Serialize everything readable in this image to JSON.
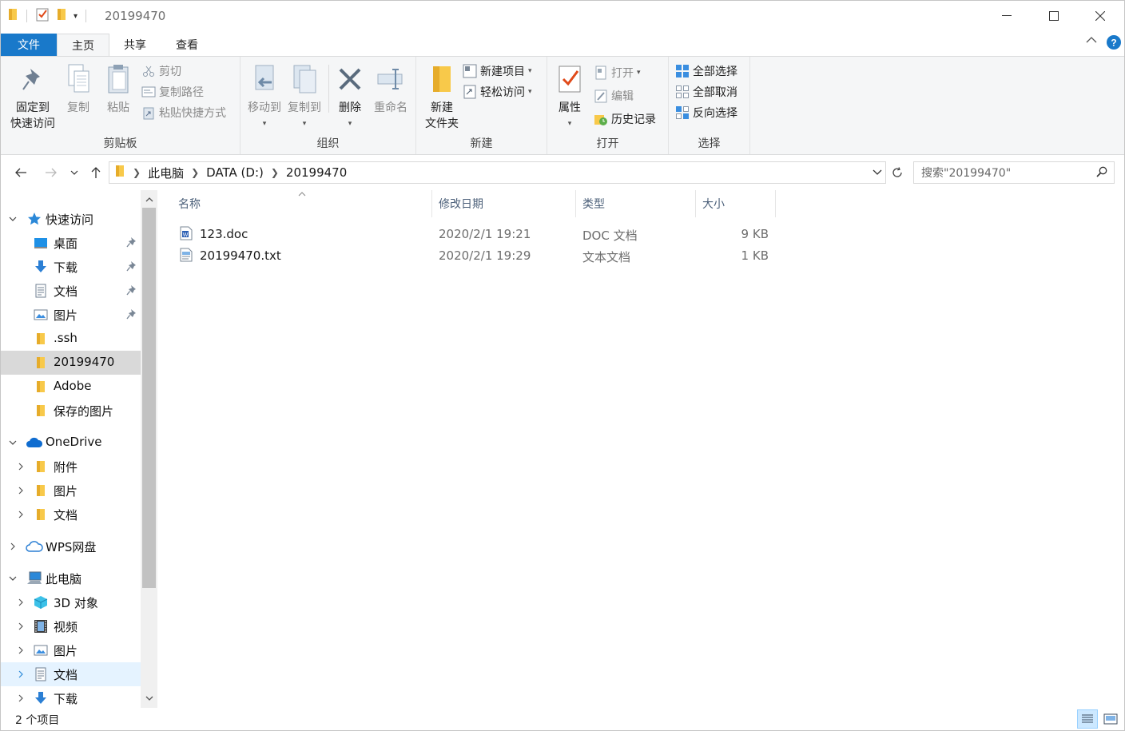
{
  "window": {
    "title": "20199470",
    "colors": {
      "accent": "#1979ca",
      "folder": "#f8c94a",
      "selected_bg": "#d9d9d9",
      "hover_bg": "#e5f3ff"
    }
  },
  "tabs": {
    "file": "文件",
    "home": "主页",
    "share": "共享",
    "view": "查看"
  },
  "ribbon": {
    "clipboard": {
      "label": "剪贴板",
      "pin_line1": "固定到",
      "pin_line2": "快速访问",
      "copy": "复制",
      "paste": "粘贴",
      "cut": "剪切",
      "copy_path": "复制路径",
      "paste_shortcut": "粘贴快捷方式"
    },
    "organize": {
      "label": "组织",
      "move_to": "移动到",
      "copy_to": "复制到",
      "delete": "删除",
      "rename": "重命名"
    },
    "new": {
      "label": "新建",
      "new_folder_line1": "新建",
      "new_folder_line2": "文件夹",
      "new_item": "新建项目",
      "easy_access": "轻松访问"
    },
    "open": {
      "label": "打开",
      "properties": "属性",
      "open": "打开",
      "edit": "编辑",
      "history": "历史记录"
    },
    "select": {
      "label": "选择",
      "select_all": "全部选择",
      "select_none": "全部取消",
      "invert": "反向选择"
    }
  },
  "address": {
    "crumbs": [
      "此电脑",
      "DATA (D:)",
      "20199470"
    ],
    "search_placeholder": "搜索\"20199470\""
  },
  "nav": {
    "quick_access": "快速访问",
    "desktop": "桌面",
    "downloads": "下载",
    "documents": "文档",
    "pictures": "图片",
    "ssh": ".ssh",
    "folder_20199470": "20199470",
    "adobe": "Adobe",
    "saved_pictures": "保存的图片",
    "onedrive": "OneDrive",
    "od_attachments": "附件",
    "od_pictures": "图片",
    "od_documents": "文档",
    "wps": "WPS网盘",
    "this_pc": "此电脑",
    "objects3d": "3D 对象",
    "videos": "视频",
    "pc_pictures": "图片",
    "pc_documents": "文档",
    "pc_downloads": "下载"
  },
  "columns": {
    "name": "名称",
    "modified": "修改日期",
    "type": "类型",
    "size": "大小"
  },
  "files": [
    {
      "name": "123.doc",
      "modified": "2020/2/1 19:21",
      "type": "DOC 文档",
      "size": "9 KB",
      "icon": "doc-file-icon"
    },
    {
      "name": "20199470.txt",
      "modified": "2020/2/1 19:29",
      "type": "文本文档",
      "size": "1 KB",
      "icon": "txt-file-icon"
    }
  ],
  "status": {
    "count": "2 个项目"
  }
}
